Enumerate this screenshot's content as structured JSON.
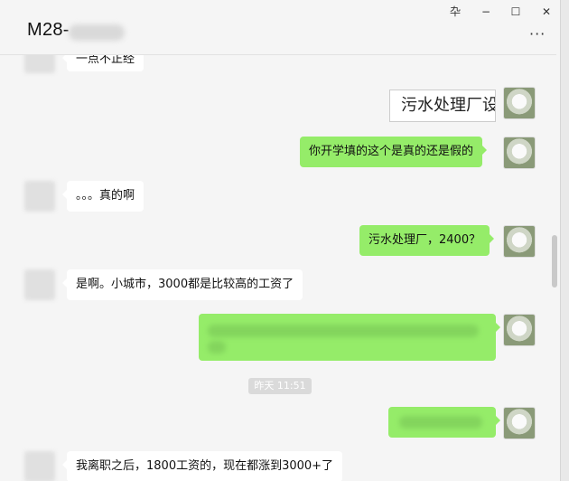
{
  "window": {
    "title": "M28-",
    "pin_glyph": "卆",
    "minimize_glyph": "−",
    "maximize_glyph": "☐",
    "close_glyph": "✕",
    "more_glyph": "···"
  },
  "messages": [
    {
      "side": "in",
      "text": "一点不正经"
    },
    {
      "side": "out",
      "type": "image",
      "text": "污水处理厂设"
    },
    {
      "side": "out",
      "text": "你开学填的这个是真的还是假的"
    },
    {
      "side": "in",
      "text": "。。。真的啊"
    },
    {
      "side": "out",
      "text": "污水处理厂，2400？"
    },
    {
      "side": "in",
      "text": "是啊。小城市，3000都是比较高的工资了"
    },
    {
      "side": "out",
      "type": "blurred",
      "text": ""
    },
    {
      "timestamp": "昨天 11:51"
    },
    {
      "side": "out",
      "type": "blurred",
      "text": ""
    },
    {
      "side": "in",
      "text": "我离职之后，1800工资的，现在都涨到3000+了"
    }
  ],
  "colors": {
    "out_bubble": "#95ec69",
    "in_bubble": "#ffffff",
    "background": "#f5f5f5"
  }
}
